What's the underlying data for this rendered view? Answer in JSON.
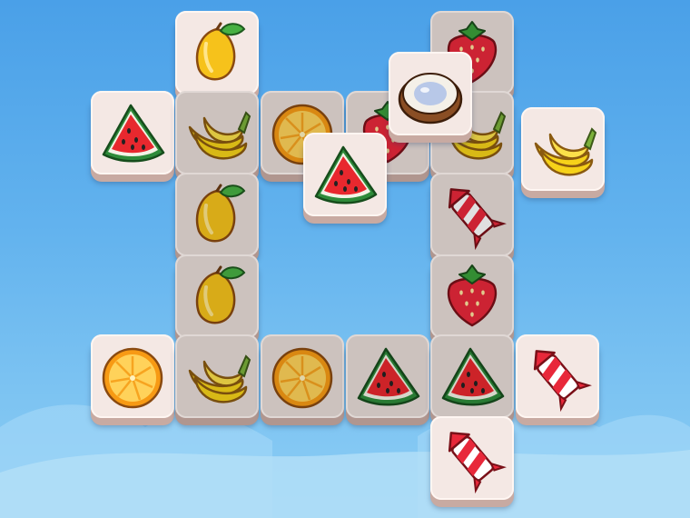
{
  "game": {
    "background_top": "#4aa0e8",
    "background_bottom": "#8ccdf4",
    "tile_face": "#f4e8e4",
    "tile_side": "#c8aaa2"
  },
  "tiles": [
    {
      "icon": "mango-icon",
      "free": true
    },
    {
      "icon": "strawberry-icon",
      "free": false
    },
    {
      "icon": "coconut-icon",
      "free": true
    },
    {
      "icon": "watermelon-icon",
      "free": true
    },
    {
      "icon": "banana-icon",
      "free": false
    },
    {
      "icon": "orange-icon",
      "free": false
    },
    {
      "icon": "strawberry-icon",
      "free": false
    },
    {
      "icon": "banana-icon",
      "free": false
    },
    {
      "icon": "banana-icon",
      "free": true
    },
    {
      "icon": "watermelon-icon",
      "free": true
    },
    {
      "icon": "mango-icon",
      "free": false
    },
    {
      "icon": "rocket-icon",
      "free": false
    },
    {
      "icon": "mango-icon",
      "free": false
    },
    {
      "icon": "strawberry-icon",
      "free": false
    },
    {
      "icon": "orange-icon",
      "free": true
    },
    {
      "icon": "banana-icon",
      "free": false
    },
    {
      "icon": "orange-icon",
      "free": false
    },
    {
      "icon": "watermelon-icon",
      "free": false
    },
    {
      "icon": "watermelon-icon",
      "free": false
    },
    {
      "icon": "rocket-icon",
      "free": true
    },
    {
      "icon": "rocket-icon",
      "free": true
    }
  ]
}
